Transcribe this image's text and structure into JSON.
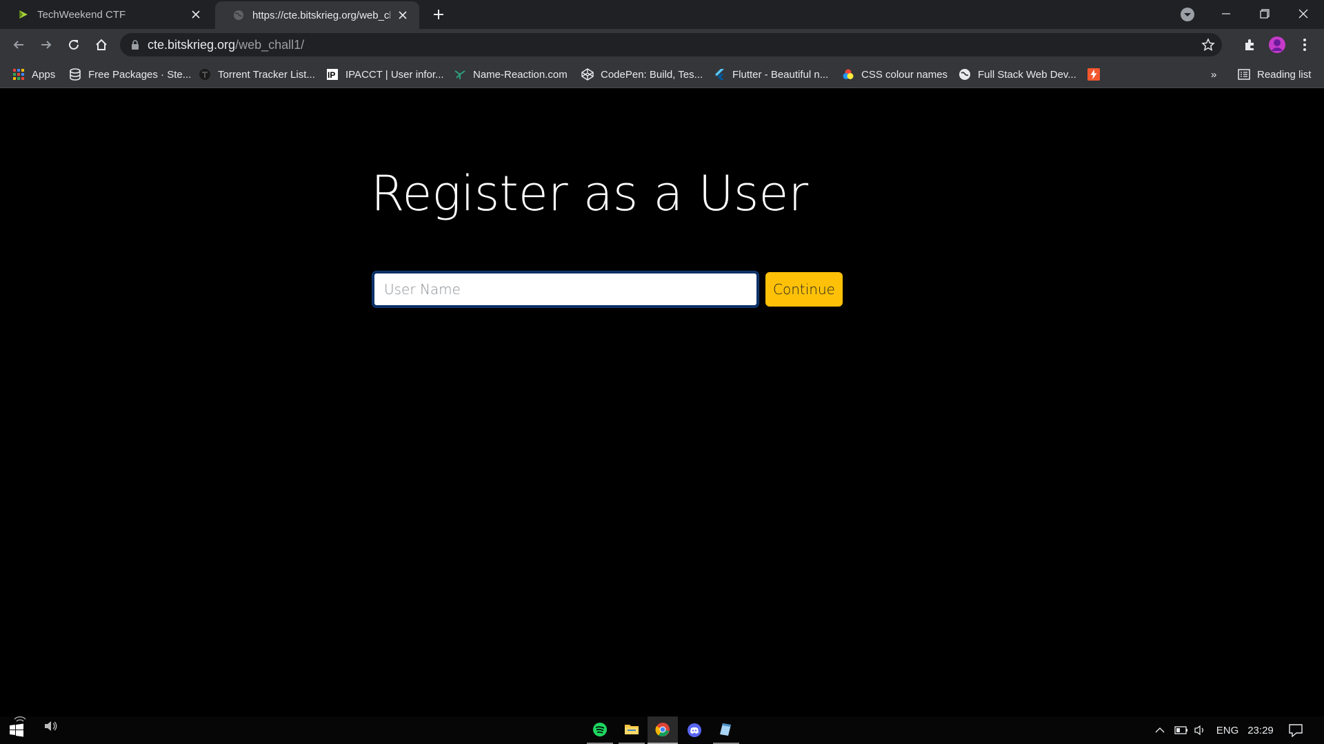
{
  "browser": {
    "tabs": [
      {
        "title": "TechWeekend CTF",
        "active": false
      },
      {
        "title": "https://cte.bitskrieg.org/web_cha",
        "active": true
      }
    ],
    "address_host": "cte.bitskrieg.org",
    "address_path": "/web_chall1/",
    "bookmarks": [
      {
        "label": "Apps",
        "icon": "apps-grid-icon"
      },
      {
        "label": "Free Packages · Ste...",
        "icon": "database-icon"
      },
      {
        "label": "Torrent Tracker List...",
        "icon": "torrent-icon"
      },
      {
        "label": "IPACCT | User infor...",
        "icon": "ipacct-icon"
      },
      {
        "label": "Name-Reaction.com",
        "icon": "molecule-icon"
      },
      {
        "label": "CodePen: Build, Tes...",
        "icon": "codepen-icon"
      },
      {
        "label": "Flutter - Beautiful n...",
        "icon": "flutter-icon"
      },
      {
        "label": "CSS colour names",
        "icon": "color-wheel-icon"
      },
      {
        "label": "Full Stack Web Dev...",
        "icon": "globe-icon"
      }
    ],
    "more_bookmarks": "»",
    "reading_list": "Reading list"
  },
  "page": {
    "title": "Register as a User",
    "input_placeholder": "User Name",
    "input_value": "",
    "button_label": "Continue",
    "button_color": "#ffc107"
  },
  "taskbar": {
    "apps": [
      "spotify-icon",
      "file-explorer-icon",
      "chrome-icon",
      "discord-icon",
      "notepad-icon"
    ],
    "language": "ENG",
    "time": "23:29"
  }
}
